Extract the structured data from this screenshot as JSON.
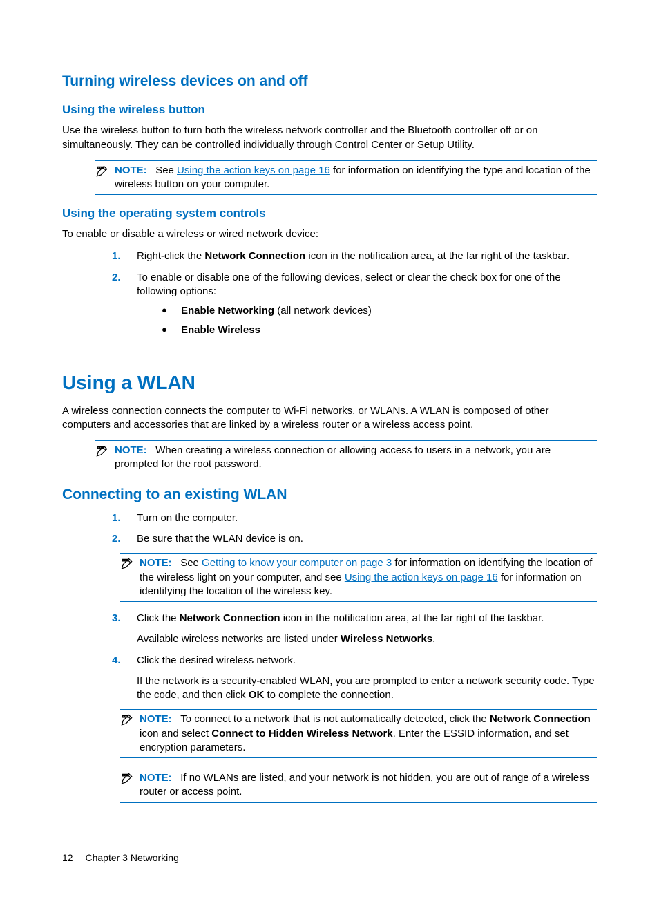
{
  "heading_turning": "Turning wireless devices on and off",
  "heading_wireless_button": "Using the wireless button",
  "para_wireless_button": "Use the wireless button to turn both the wireless network controller and the Bluetooth controller off or on simultaneously. They can be controlled individually through Control Center or Setup Utility.",
  "note_label": "NOTE:",
  "note1_prefix": "See ",
  "link_action_keys": "Using the action keys on page 16",
  "note1_suffix": " for information on identifying the type and location of the wireless button on your computer.",
  "heading_os_controls": "Using the operating system controls",
  "para_os_controls": "To enable or disable a wireless or wired network device:",
  "step1_num": "1.",
  "step1_a": "Right-click the ",
  "step1_b_bold": "Network Connection",
  "step1_c": " icon in the notification area, at the far right of the taskbar.",
  "step2_num": "2.",
  "step2_text": "To enable or disable one of the following devices, select or clear the check box for one of the following options:",
  "bullet_dot": "●",
  "bullet1_bold": "Enable Networking",
  "bullet1_rest": " (all network devices)",
  "bullet2_bold": "Enable Wireless",
  "heading_wlan": "Using a WLAN",
  "para_wlan": "A wireless connection connects the computer to Wi-Fi networks, or WLANs. A WLAN is composed of other computers and accessories that are linked by a wireless router or a wireless access point.",
  "note2_text": "When creating a wireless connection or allowing access to users in a network, you are prompted for the root password.",
  "heading_connecting": "Connecting to an existing WLAN",
  "conn_step1_num": "1.",
  "conn_step1": "Turn on the computer.",
  "conn_step2_num": "2.",
  "conn_step2": "Be sure that the WLAN device is on.",
  "note3_prefix": "See ",
  "link_know_computer": "Getting to know your computer on page 3",
  "note3_mid": " for information on identifying the location of the wireless light on your computer, and see ",
  "note3_suffix": " for information on identifying the location of the wireless key.",
  "conn_step3_num": "3.",
  "conn_step3_a": "Click the ",
  "conn_step3_b_bold": "Network Connection",
  "conn_step3_c": " icon in the notification area, at the far right of the taskbar.",
  "conn_step3_sub_a": "Available wireless networks are listed under ",
  "conn_step3_sub_b_bold": "Wireless Networks",
  "conn_step3_sub_c": ".",
  "conn_step4_num": "4.",
  "conn_step4": "Click the desired wireless network.",
  "conn_step4_sub_a": "If the network is a security-enabled WLAN, you are prompted to enter a network security code. Type the code, and then click ",
  "conn_step4_sub_b_bold": "OK",
  "conn_step4_sub_c": " to complete the connection.",
  "note4_a": "To connect to a network that is not automatically detected, click the ",
  "note4_b_bold": "Network Connection",
  "note4_c": " icon and select ",
  "note4_d_bold": "Connect to Hidden Wireless Network",
  "note4_e": ". Enter the ESSID information, and set encryption parameters.",
  "note5_text": "If no WLANs are listed, and your network is not hidden, you are out of range of a wireless router or access point.",
  "footer_page": "12",
  "footer_chapter": "Chapter 3   Networking"
}
